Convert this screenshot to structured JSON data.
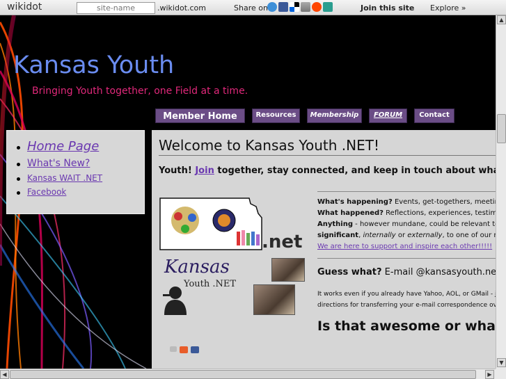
{
  "topbar": {
    "logo": "wikidot",
    "site_name_placeholder": "site-name",
    "site_suffix": ".wikidot.com",
    "share_label": "Share on",
    "join_label": "Join this site",
    "explore_label": "Explore »"
  },
  "header": {
    "title": "Kansas Youth",
    "subtitle": "Bringing Youth together, one Field at a time."
  },
  "nav": {
    "items": [
      {
        "label": "Member Home"
      },
      {
        "label": "Resources"
      },
      {
        "label": "Membership"
      },
      {
        "label": "FORUM"
      },
      {
        "label": "Contact"
      }
    ]
  },
  "sidebar": {
    "items": [
      {
        "label": "Home Page"
      },
      {
        "label": "What's New?"
      },
      {
        "label": "Kansas WAIT .NET"
      },
      {
        "label": "Facebook"
      }
    ]
  },
  "content": {
    "title": "Welcome to Kansas Youth .NET!",
    "intro_before": "Youth! ",
    "intro_link": "Join",
    "intro_after": " together, stay connected, and keep in touch about what",
    "logo_dotnet": ".net",
    "logo_kansas": "Kansas",
    "logo_youthnet": "Youth .NET",
    "whats_happening_label": "What's happening?",
    "whats_happening_text": " Events, get-togethers, meetings",
    "what_happened_label": "What happened?",
    "what_happened_text": " Reflections, experiences, testimon",
    "anything_label": "Anything",
    "anything_text": " - however mundane, could be relevant to o",
    "significant_label": "significant",
    "significant_sep1": ", ",
    "internally": "internally",
    "significant_sep2": " or ",
    "externally": "externally",
    "significant_tail": ", to one of our mem",
    "support_link": "We are here to support and inspire each other!!!!!",
    "guess_label": "Guess what?",
    "guess_text": " E-mail @kansasyouth.net!",
    "works_line1": "It works even if you already have Yahoo, AOL, or GMail - j",
    "works_line2": "directions for transferring your e-mail correspondence ove",
    "awesome": "Is that awesome or what??"
  },
  "colors": {
    "title": "#6a8cf0",
    "subtitle": "#e0287a",
    "nav_bg": "#6b4d86",
    "link": "#6a38b0"
  }
}
